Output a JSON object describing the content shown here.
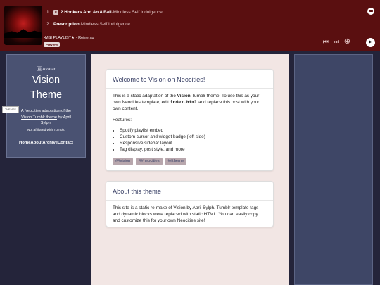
{
  "spotify": {
    "tracks": [
      {
        "num": "1",
        "explicit": "E",
        "title": "2 Hookers And An 8 Ball",
        "separator": " · ",
        "artist": "Mindless Self Indulgence"
      },
      {
        "num": "2",
        "explicit": "",
        "title": "Prescription",
        "separator": " · ",
        "artist": "Mindless Self Indulgence"
      }
    ],
    "playlist_title": "•MSI PLAYLIST★ · Reinerxp",
    "preview_label": "Preview",
    "icons": [
      "spotify-logo-icon",
      "prev-track-icon",
      "next-track-icon",
      "add-circle-icon",
      "more-icon",
      "play-icon"
    ]
  },
  "sidebar": {
    "avatar_alt": "Avatar",
    "title_line1": "Vision",
    "title_line2": "Theme",
    "desc_before": "A Neocities adaptation of the ",
    "desc_link": "Vision Tumblr theme",
    "desc_after": " by April Sylph.",
    "note": "Not affiliated with Tumblr.",
    "nav": [
      "Home",
      "About",
      "Archive",
      "Contact"
    ],
    "themes_tab": "THEMES"
  },
  "posts": [
    {
      "title": "Welcome to Vision on Neocities!",
      "p1_a": "This is a static adaptation of the ",
      "p1_bold": "Vision",
      "p1_b": " Tumblr theme. To use this as your own Neocities template, edit ",
      "p1_code": "index.html",
      "p1_c": " and replace this post with your own content.",
      "features_label": "Features:",
      "features": [
        "Spotify playlist embed",
        "Custom cursor and widget badge (left side)",
        "Responsive sidebar layout",
        "Tag display, post style, and more"
      ],
      "tags": [
        "##vision",
        "##neocities",
        "##theme"
      ]
    },
    {
      "title": "About this theme",
      "p_a": "This site is a static re-make of ",
      "p_link": "Vision by April Sylph",
      "p_b": ". Tumblr template tags and dynamic blocks were replaced with static HTML. You can easily copy and customize this for your own Neocities site!"
    }
  ],
  "colors": {
    "spotify_bg": "#5a0f10",
    "page_bg": "#24243a",
    "main_bg": "#f2e6e4",
    "sidebar_bg": "#4a5272",
    "tag_bg": "#b8a7ad",
    "heading": "#3c4368"
  }
}
